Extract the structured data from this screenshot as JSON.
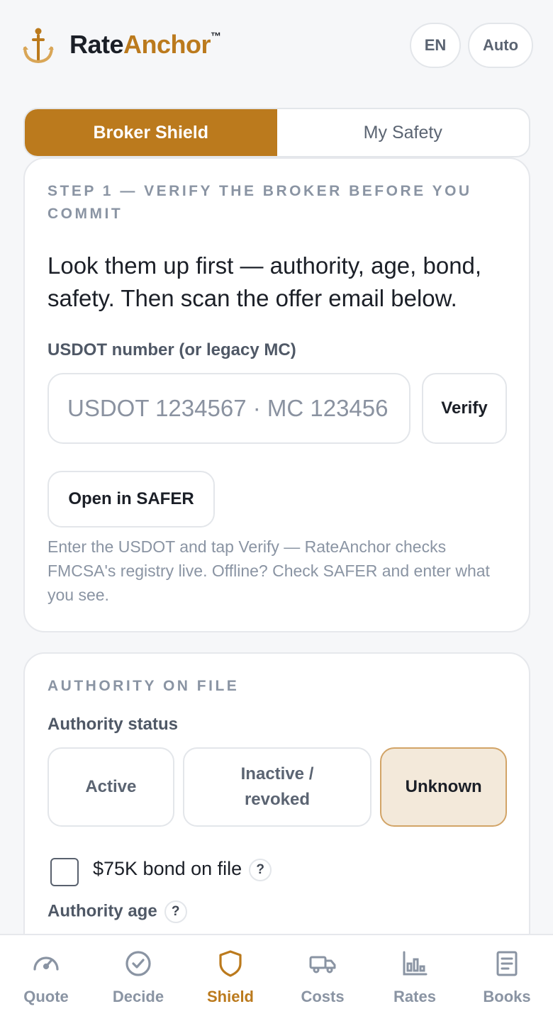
{
  "header": {
    "brand_part1": "Rate",
    "brand_part2": "Anchor",
    "trademark": "™",
    "logo_icon": "anchor-icon",
    "language_label": "EN",
    "theme_label": "Auto"
  },
  "tabs": [
    {
      "label": "Broker Shield",
      "active": true
    },
    {
      "label": "My Safety",
      "active": false
    }
  ],
  "step_card": {
    "eyebrow": "STEP 1 — VERIFY THE BROKER BEFORE YOU COMMIT",
    "lead": "Look them up first — authority, age, bond, safety. Then scan the offer email below.",
    "field_label": "USDOT number (or legacy MC)",
    "input_placeholder": "USDOT 1234567 · MC 123456",
    "verify_label": "Verify",
    "safer_label": "Open in SAFER",
    "hint": "Enter the USDOT and tap Verify — RateAnchor checks FMCSA's registry live. Offline? Check SAFER and enter what you see."
  },
  "authority_card": {
    "eyebrow": "AUTHORITY ON FILE",
    "status_label": "Authority status",
    "status_options": [
      "Active",
      "Inactive / revoked",
      "Unknown"
    ],
    "selected_status": "Unknown",
    "bond_label": "$75K bond on file",
    "bond_checked": false,
    "age_label": "Authority age",
    "help_glyph": "?"
  },
  "bottom_nav": [
    {
      "label": "Quote",
      "icon": "speedometer-icon",
      "active": false
    },
    {
      "label": "Decide",
      "icon": "check-circle-icon",
      "active": false
    },
    {
      "label": "Shield",
      "icon": "shield-icon",
      "active": true
    },
    {
      "label": "Costs",
      "icon": "truck-icon",
      "active": false
    },
    {
      "label": "Rates",
      "icon": "bar-chart-icon",
      "active": false
    },
    {
      "label": "Books",
      "icon": "document-icon",
      "active": false
    }
  ],
  "colors": {
    "accent": "#bb7a1d",
    "selected_bg": "#f3e9da",
    "muted": "#8a94a3"
  }
}
